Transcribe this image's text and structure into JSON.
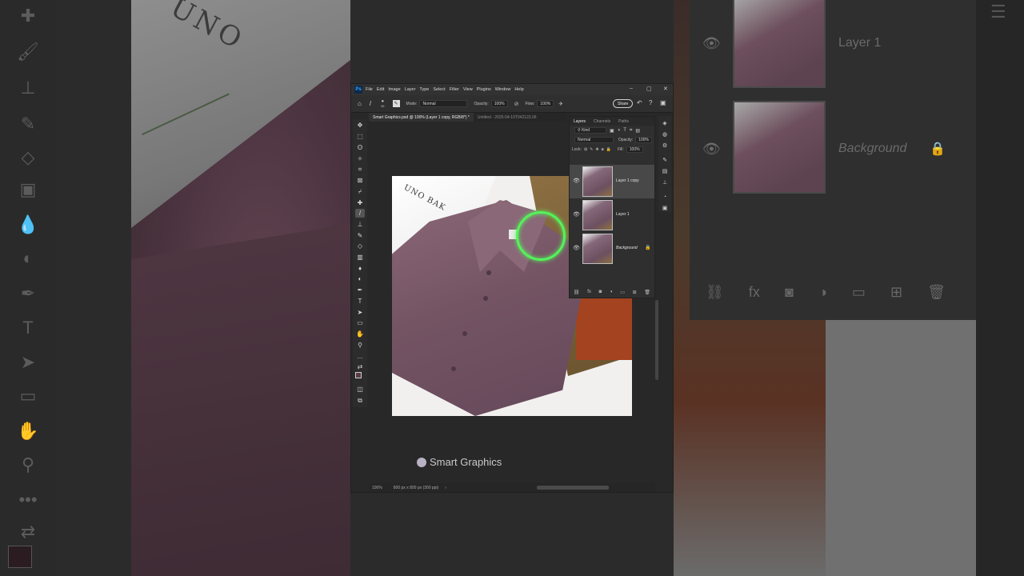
{
  "app": {
    "menu": [
      "File",
      "Edit",
      "Image",
      "Layer",
      "Type",
      "Select",
      "Filter",
      "View",
      "Plugins",
      "Window",
      "Help"
    ],
    "logo": "Ps"
  },
  "options": {
    "brush_size": "96",
    "mode_label": "Mode:",
    "mode_value": "Normal",
    "opacity_label": "Opacity:",
    "opacity_value": "100%",
    "flow_label": "Flow:",
    "flow_value": "100%",
    "share_label": "Share"
  },
  "tabs": [
    {
      "label": "Smart Graphics.psd @ 100% (Layer 1 copy, RGB/8*) *",
      "active": true
    },
    {
      "label": "Untitled - 2025-04-10T042123.06",
      "active": false
    }
  ],
  "layers_panel": {
    "tabs": [
      "Layers",
      "Channels",
      "Paths"
    ],
    "filter_label": "Kind",
    "blend_mode": "Normal",
    "opacity_label": "Opacity:",
    "opacity_value": "100%",
    "lock_label": "Lock:",
    "fill_label": "Fill:",
    "fill_value": "100%",
    "layers": [
      {
        "name": "Layer 1 copy",
        "selected": true,
        "locked": false
      },
      {
        "name": "Layer 1",
        "selected": false,
        "locked": false
      },
      {
        "name": "Background",
        "selected": false,
        "locked": true
      }
    ]
  },
  "status": {
    "zoom": "100%",
    "doc_size": "800 px x 800 px (300 ppi)"
  },
  "canvas": {
    "watermark": "Smart Graphics",
    "paper_text": "UNO BAK"
  },
  "background_mirror": {
    "left_text": "UNO",
    "layer_labels": [
      "Layer 1",
      "Background"
    ]
  },
  "colors": {
    "brush_ring": "#55f25a",
    "shirt": "#745463",
    "ui_dark": "#282828"
  }
}
